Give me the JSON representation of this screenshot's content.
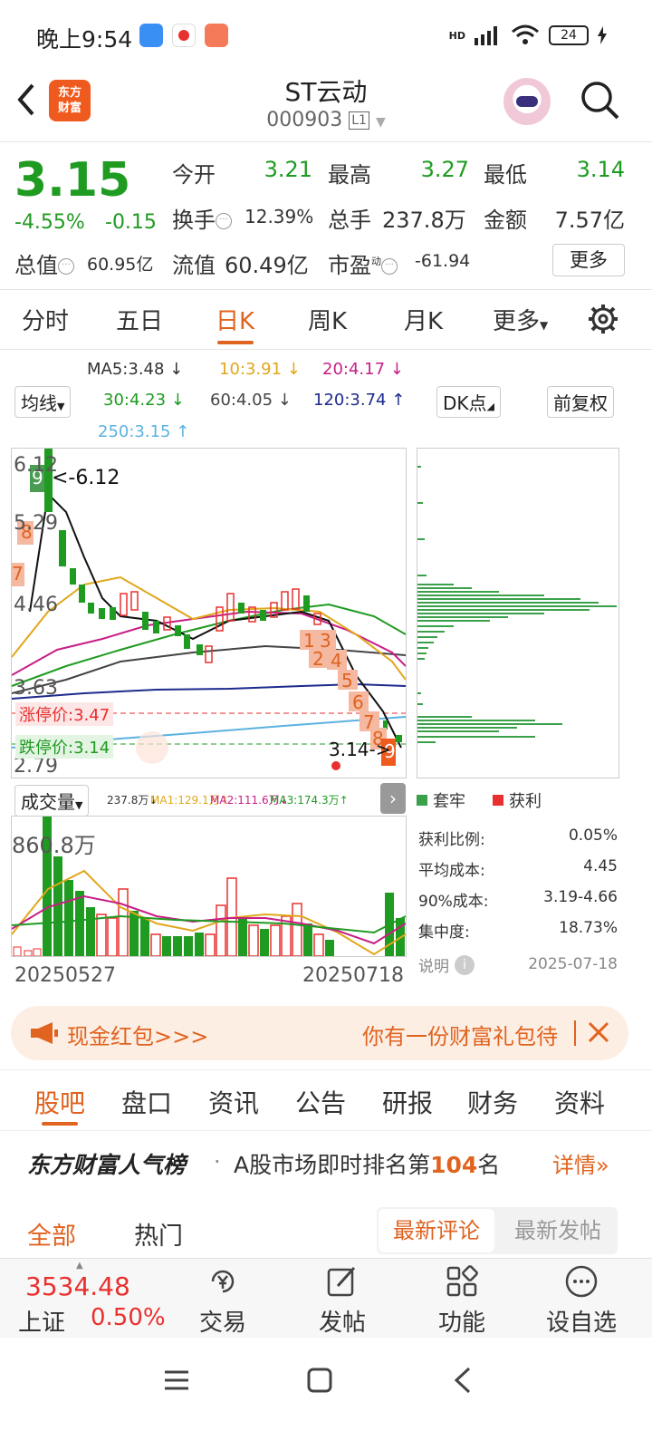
{
  "status": {
    "time": "晚上9:54",
    "network": "HD",
    "battery": "24"
  },
  "header": {
    "stock_name": "ST云动",
    "stock_code": "000903",
    "level_badge": "L1",
    "brand_line1": "东方",
    "brand_line2": "财富"
  },
  "quote": {
    "price": "3.15",
    "change_pct": "-4.55%",
    "change_val": "-0.15",
    "open_label": "今开",
    "open": "3.21",
    "high_label": "最高",
    "high": "3.27",
    "low_label": "最低",
    "low": "3.14",
    "turnover_label": "换手",
    "turnover": "12.39%",
    "volume_label": "总手",
    "volume": "237.8万",
    "amount_label": "金额",
    "amount": "7.57亿",
    "total_cap_label": "总值",
    "total_cap": "60.95亿",
    "float_cap_label": "流值",
    "float_cap": "60.49亿",
    "pe_label": "市盈",
    "pe_sup": "动",
    "pe": "-61.94",
    "more_label": "更多"
  },
  "period_tabs": [
    "分时",
    "五日",
    "日K",
    "周K",
    "月K",
    "更多"
  ],
  "ma_legend": {
    "ma5": "MA5:3.48",
    "ma10": "10:3.91",
    "ma20": "20:4.17",
    "ma30": "30:4.23",
    "ma60": "60:4.05",
    "ma120": "120:3.74",
    "ma250": "250:3.15",
    "avg_line_select": "均线",
    "dk_label": "DK点",
    "fq_label": "前复权"
  },
  "kline": {
    "y_labels": [
      "6.12",
      "5.29",
      "4.46",
      "3.63",
      "2.79"
    ],
    "max_marker": "<-6.12",
    "limit_up": "涨停价:3.47",
    "limit_down": "跌停价:3.14",
    "last_marker": "3.14->",
    "dk_numbers": [
      "9",
      "8",
      "7",
      "1",
      "2",
      "3",
      "4",
      "5",
      "6",
      "7",
      "8",
      "9"
    ]
  },
  "volume": {
    "select": "成交量",
    "vol": "237.8万",
    "ma1": "MA1:129.1万",
    "ma2": "MA2:111.6万",
    "ma3": "MA3:174.3万",
    "max": "860.8万",
    "date_start": "20250527",
    "date_end": "20250718"
  },
  "chip": {
    "legend_loss": "套牢",
    "legend_profit": "获利",
    "profit_ratio_label": "获利比例:",
    "profit_ratio": "0.05%",
    "avg_cost_label": "平均成本:",
    "avg_cost": "4.45",
    "cost90_label": "90%成本:",
    "cost90": "3.19-4.66",
    "concentration_label": "集中度:",
    "concentration": "18.73%",
    "note_label": "说明",
    "date": "2025-07-18"
  },
  "promo": {
    "left_text": "现金红包>>>",
    "right_text": "你有一份财富礼包待"
  },
  "sub_tabs": [
    "股吧",
    "盘口",
    "资讯",
    "公告",
    "研报",
    "财务",
    "资料"
  ],
  "rank": {
    "title": "东方财富人气榜",
    "prefix": "A股市场即时排名第",
    "rank": "104",
    "suffix": "名",
    "detail": "详情"
  },
  "feed_tabs": {
    "all": "全部",
    "hot": "热门",
    "latest_comment": "最新评论",
    "latest_post": "最新发帖"
  },
  "bottom_bar": {
    "index_value": "3534.48",
    "index_name": "上证",
    "index_change": "0.50%",
    "trade": "交易",
    "post": "发帖",
    "func": "功能",
    "watch": "设自选"
  },
  "colors": {
    "up": "#e8302e",
    "down": "#1f9b21",
    "accent": "#e0631f"
  }
}
